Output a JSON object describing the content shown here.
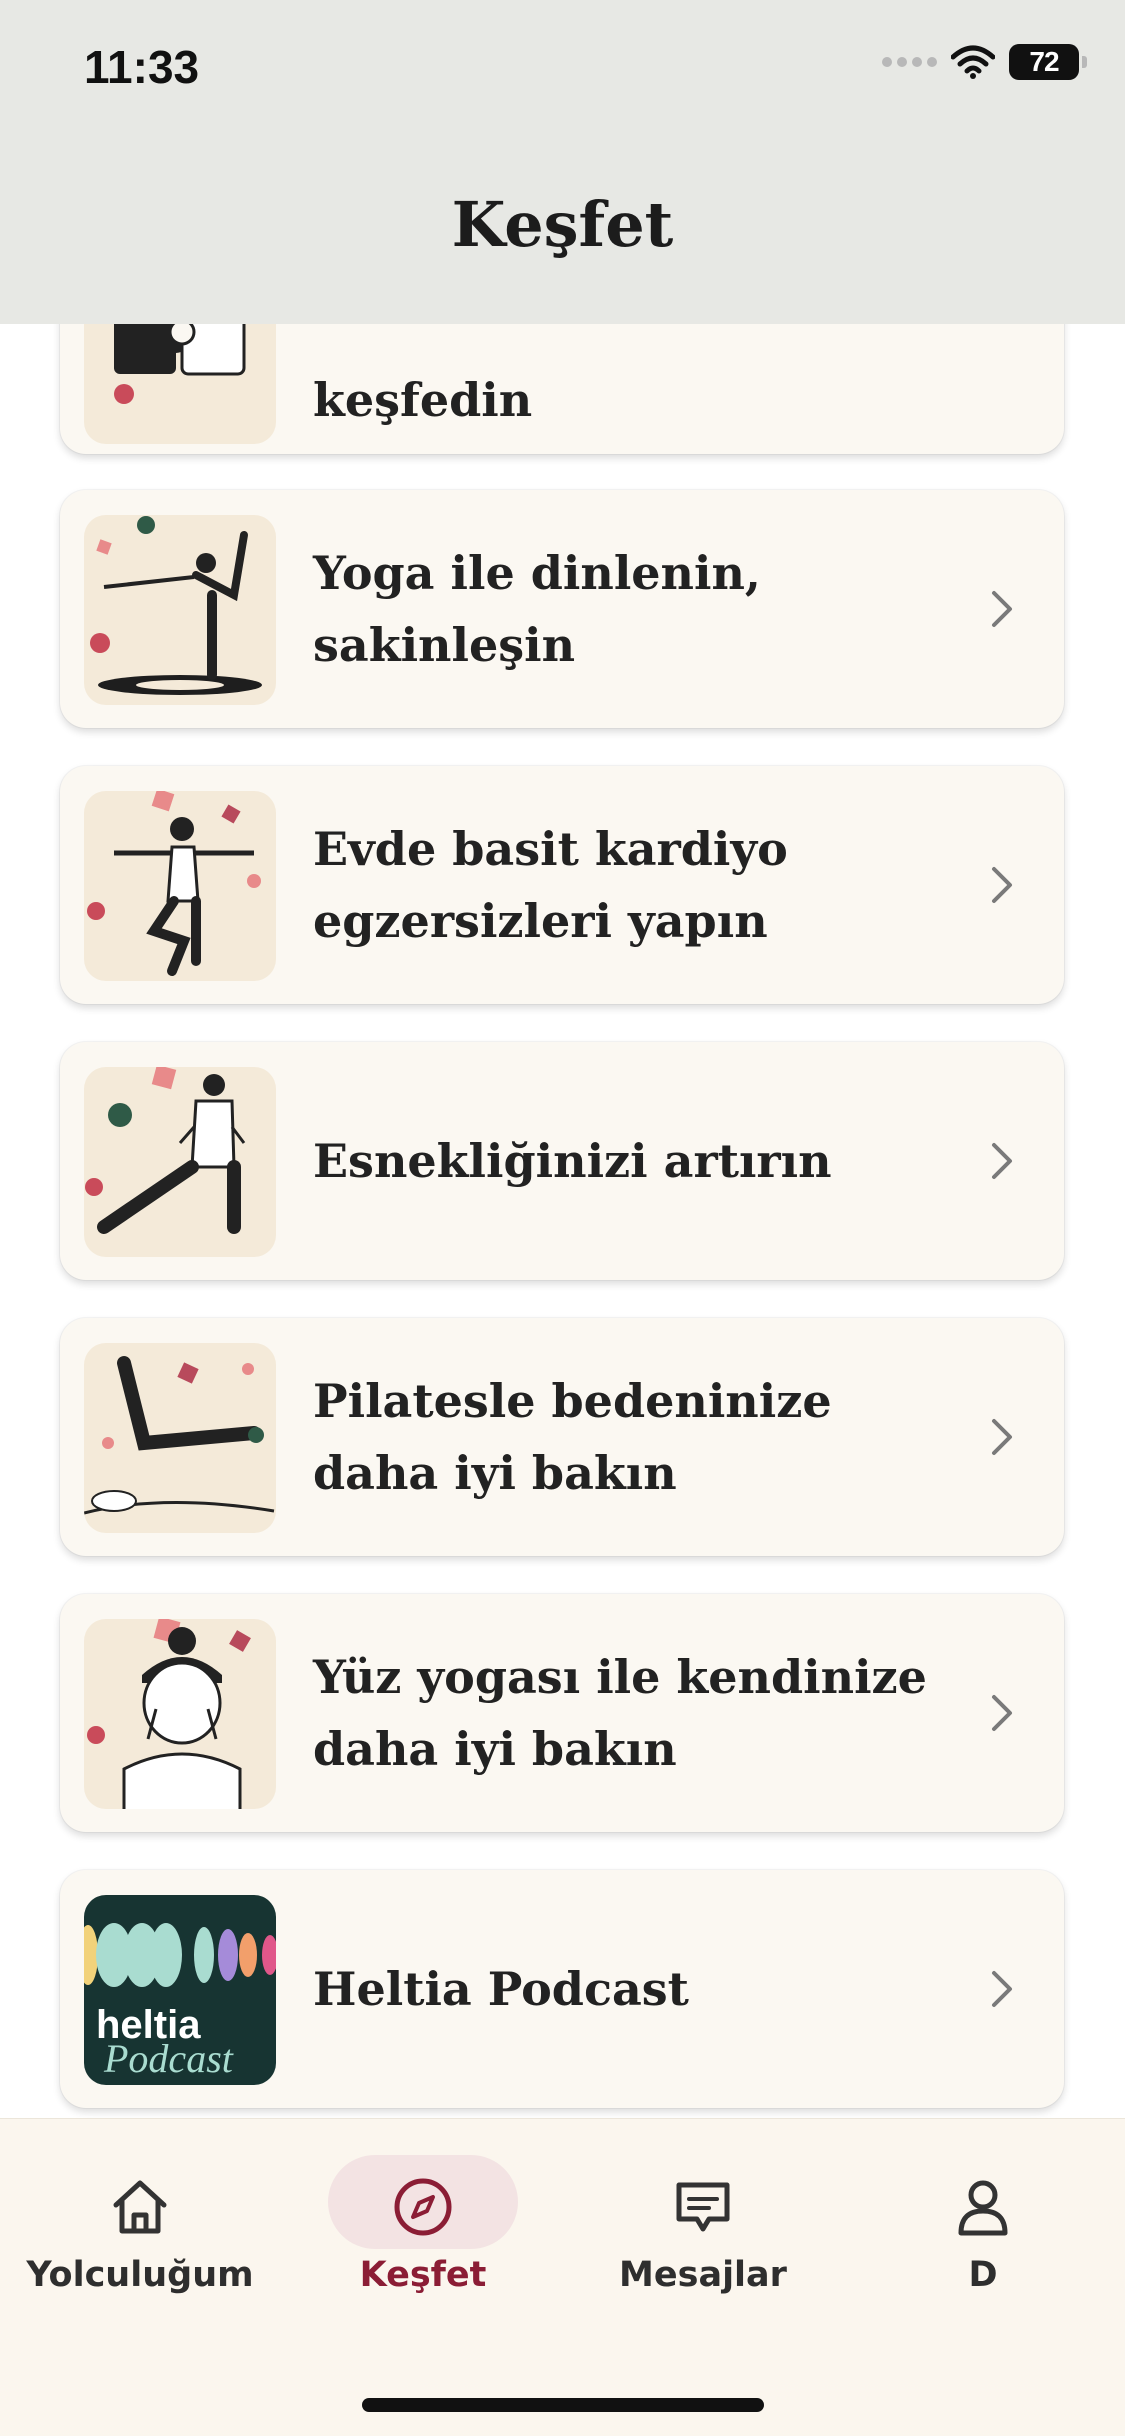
{
  "status_bar": {
    "time": "11:33",
    "battery": "72"
  },
  "header": {
    "title": "Keşfet"
  },
  "cards": [
    {
      "title": "keşfedin",
      "illustration": "puzzle-illustration"
    },
    {
      "title": "Yoga ile dinlenin, sakinleşin",
      "illustration": "yoga-pose-illustration"
    },
    {
      "title": "Evde basit kardiyo egzersizleri yapın",
      "illustration": "cardio-dance-illustration"
    },
    {
      "title": "Esnekliğinizi artırın",
      "illustration": "stretching-illustration"
    },
    {
      "title": "Pilatesle bedeninize daha iyi bakın",
      "illustration": "pilates-illustration"
    },
    {
      "title": "Yüz yogası ile kendinize daha iyi bakın",
      "illustration": "face-yoga-illustration"
    },
    {
      "title": "Heltia Podcast",
      "illustration": "podcast-cover",
      "cover_text_1": "heltia",
      "cover_text_2": "Podcast"
    }
  ],
  "tabs": [
    {
      "label": "Yolculuğum",
      "icon": "home-icon",
      "active": false
    },
    {
      "label": "Keşfet",
      "icon": "compass-icon",
      "active": true
    },
    {
      "label": "Mesajlar",
      "icon": "chat-icon",
      "active": false
    },
    {
      "label": "D",
      "icon": "profile-icon",
      "active": false
    }
  ],
  "colors": {
    "accent": "#8b1d35",
    "card_bg": "#fbf8f2",
    "header_bg": "#e7e8e4",
    "thumb_bg": "#f4ead9",
    "podcast_bg": "#173432"
  }
}
